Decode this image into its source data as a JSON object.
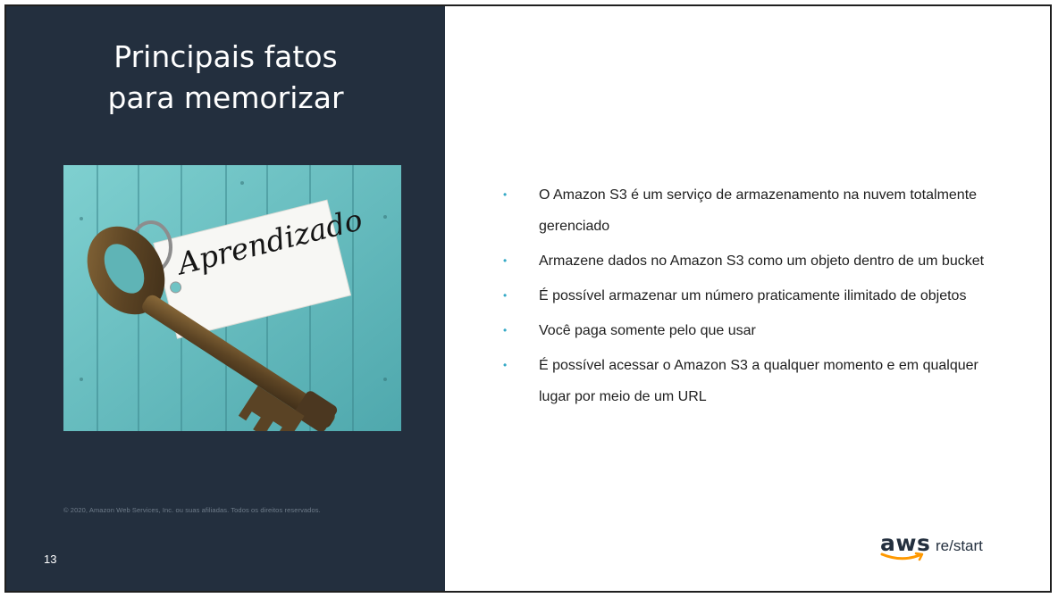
{
  "slide": {
    "title_line1": "Principais fatos",
    "title_line2": "para memorizar",
    "image_tag_text": "Aprendizado",
    "copyright": "© 2020, Amazon Web Services, Inc. ou suas afiliadas. Todos os direitos reservados.",
    "page_number": "13",
    "bullets": [
      "O Amazon S3 é um serviço de armazenamento na nuvem totalmente gerenciado",
      "Armazene dados no Amazon S3 como um objeto dentro de um bucket",
      "É possível armazenar um número praticamente ilimitado de objetos",
      "Você paga somente pelo que usar",
      "É possível acessar o Amazon S3 a qualquer momento e em qualquer lugar por meio de um URL"
    ],
    "logo": {
      "aws_word": "aws",
      "restart_word": "re/start"
    }
  },
  "colors": {
    "left_panel": "#232f3e",
    "bullet": "#35a9c6",
    "smile": "#ff9900"
  }
}
